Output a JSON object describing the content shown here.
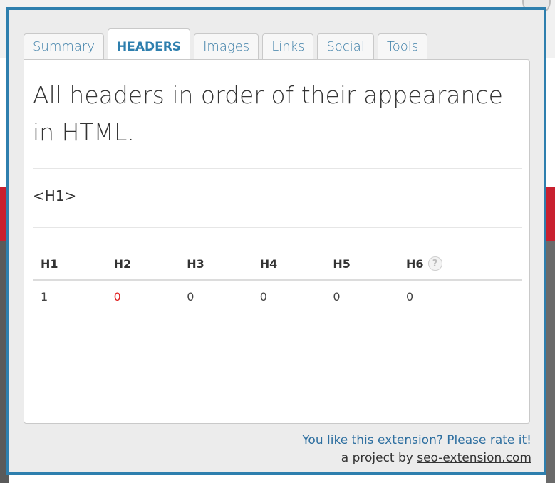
{
  "tabs": [
    {
      "label": "Summary",
      "active": false
    },
    {
      "label": "HEADERS",
      "active": true
    },
    {
      "label": "Images",
      "active": false
    },
    {
      "label": "Links",
      "active": false
    },
    {
      "label": "Social",
      "active": false
    },
    {
      "label": "Tools",
      "active": false
    }
  ],
  "panel": {
    "title": "All headers in order of their appearance in HTML.",
    "h1_tag": "<H1>"
  },
  "table": {
    "headers": [
      "H1",
      "H2",
      "H3",
      "H4",
      "H5",
      "H6"
    ],
    "values": [
      "1",
      "0",
      "0",
      "0",
      "0",
      "0"
    ],
    "help_icon": "?"
  },
  "footer": {
    "rate_link": "You like this extension? Please rate it!",
    "project_prefix": "a project by ",
    "project_link": "seo-extension.com"
  },
  "colors": {
    "border": "#2e7fae",
    "tab_text": "#3d7fa8",
    "warning": "#e02020",
    "link": "#2e6fa0"
  }
}
